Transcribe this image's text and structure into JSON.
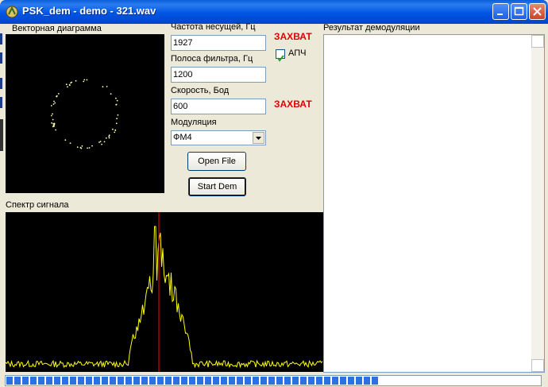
{
  "window": {
    "title": "PSK_dem - demo - 321.wav"
  },
  "vector_diagram": {
    "label": "Векторная диаграмма"
  },
  "carrier": {
    "label": "Частота несущей, Гц",
    "value": "1927",
    "status": "ЗАХВАТ"
  },
  "afc": {
    "label": "АПЧ",
    "checked": true
  },
  "filter_band": {
    "label": "Полоса фильтра, Гц",
    "value": "1200"
  },
  "speed": {
    "label": "Скорость, Бод",
    "value": "600",
    "status": "ЗАХВАТ"
  },
  "modulation": {
    "label": "Модуляция",
    "selected": "ФМ4"
  },
  "buttons": {
    "open_file": "Open File",
    "start_dem": "Start Dem"
  },
  "spectrum": {
    "label": "Спектр сигнала"
  },
  "result": {
    "label": "Результат демодуляции"
  },
  "progress": {
    "fraction": 0.7
  },
  "colors": {
    "title_blue": "#0055e5",
    "status_red": "#e00000",
    "spectrum_trace": "#ffff00",
    "marker_red": "#ff0000",
    "progress_blue": "#2f6fe0"
  }
}
